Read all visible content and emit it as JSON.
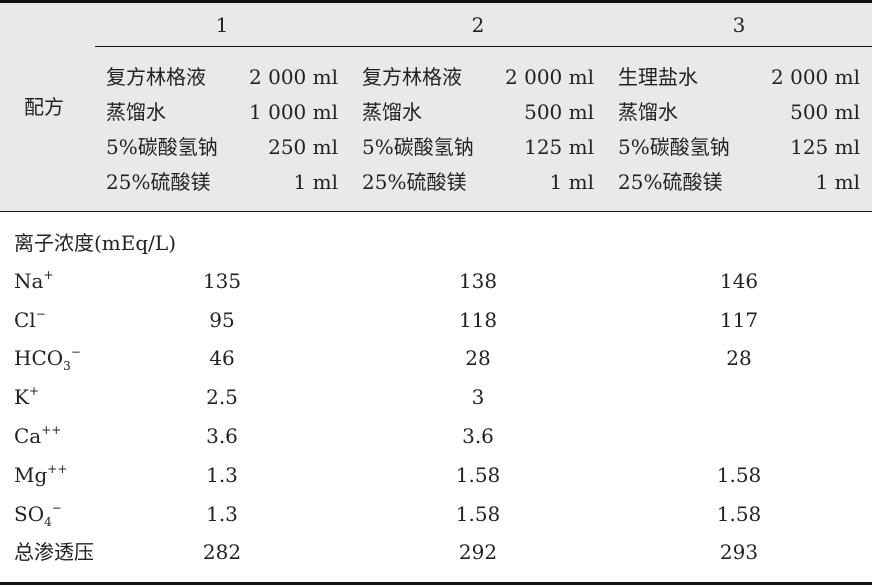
{
  "header": {
    "row_label": "配方",
    "columns": [
      "1",
      "2",
      "3"
    ]
  },
  "formulas": [
    {
      "items": [
        {
          "name": "复方林格液",
          "amount": "2 000 ml"
        },
        {
          "name": "蒸馏水",
          "amount": "1 000 ml"
        },
        {
          "name": "5%碳酸氢钠",
          "amount": "250 ml"
        },
        {
          "name": "25%硫酸镁",
          "amount": "1 ml"
        }
      ]
    },
    {
      "items": [
        {
          "name": "复方林格液",
          "amount": "2 000 ml"
        },
        {
          "name": "蒸馏水",
          "amount": "500 ml"
        },
        {
          "name": "5%碳酸氢钠",
          "amount": "125 ml"
        },
        {
          "name": "25%硫酸镁",
          "amount": "1 ml"
        }
      ]
    },
    {
      "items": [
        {
          "name": "生理盐水",
          "amount": "2 000 ml"
        },
        {
          "name": "蒸馏水",
          "amount": "500 ml"
        },
        {
          "name": "5%碳酸氢钠",
          "amount": "125 ml"
        },
        {
          "name": "25%硫酸镁",
          "amount": "1 ml"
        }
      ]
    }
  ],
  "section_label": "离子浓度(mEq/L)",
  "ions": [
    {
      "base": "Na",
      "sub": "",
      "sup": "+",
      "values": [
        "135",
        "138",
        "146"
      ]
    },
    {
      "base": "Cl",
      "sub": "",
      "sup": "−",
      "values": [
        "95",
        "118",
        "117"
      ]
    },
    {
      "base": "HCO",
      "sub": "3",
      "sup": "−",
      "values": [
        "46",
        "28",
        "28"
      ]
    },
    {
      "base": "K",
      "sub": "",
      "sup": "+",
      "values": [
        "2.5",
        "3",
        ""
      ]
    },
    {
      "base": "Ca",
      "sub": "",
      "sup": "++",
      "values": [
        "3.6",
        "3.6",
        ""
      ]
    },
    {
      "base": "Mg",
      "sub": "",
      "sup": "++",
      "values": [
        "1.3",
        "1.58",
        "1.58"
      ]
    },
    {
      "base": "SO",
      "sub": "4",
      "sup": "−",
      "values": [
        "1.3",
        "1.58",
        "1.58"
      ]
    }
  ],
  "osmolarity": {
    "label": "总渗透压",
    "values": [
      "282",
      "292",
      "293"
    ]
  }
}
